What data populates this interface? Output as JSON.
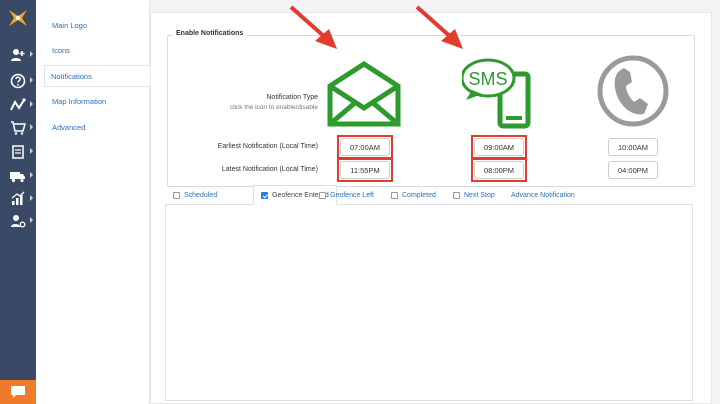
{
  "sidebar": {
    "items": [
      {
        "label": "Main Logo"
      },
      {
        "label": "Icons"
      },
      {
        "label": "Notifications"
      },
      {
        "label": "Map Information"
      },
      {
        "label": "Advanced"
      }
    ]
  },
  "rail": {
    "icons": [
      "add-user-icon",
      "help-icon",
      "routes-icon",
      "cart-icon",
      "truck-icon",
      "analytics-icon",
      "user-settings-icon"
    ]
  },
  "notifications": {
    "legend": "Enable Notifications",
    "type_label": "Notification Type",
    "type_hint": "click the icon to enable/disable",
    "earliest_label": "Earliest Notification (Local Time)",
    "latest_label": "Latest Notification (Local Time)",
    "channels": [
      {
        "name": "email",
        "icon": "envelope-icon",
        "enabled": true,
        "color": "#2e9a2e",
        "earliest": "07:00AM",
        "latest": "11:55PM"
      },
      {
        "name": "sms",
        "icon_text": "SMS",
        "icon": "sms-phone-icon",
        "enabled": true,
        "color": "#2e9a2e",
        "earliest": "09:00AM",
        "latest": "08:00PM"
      },
      {
        "name": "voice",
        "icon": "phone-handset-icon",
        "enabled": false,
        "color": "#9a9a9a",
        "earliest": "10:00AM",
        "latest": "04:00PM"
      }
    ]
  },
  "tabs": [
    {
      "label": "Scheduled",
      "checked": false
    },
    {
      "label": "Geofence Entered",
      "checked": true
    },
    {
      "label": "Geofence Left",
      "checked": false
    },
    {
      "label": "Completed",
      "checked": false
    },
    {
      "label": "Next Stop",
      "checked": false
    },
    {
      "label": "Advance Notification"
    }
  ],
  "colors": {
    "highlight": "#e23b2f",
    "arrow": "#e23b2f",
    "accent": "#2a6fb8",
    "rail": "#3a4a66",
    "chat": "#f07a2a"
  }
}
